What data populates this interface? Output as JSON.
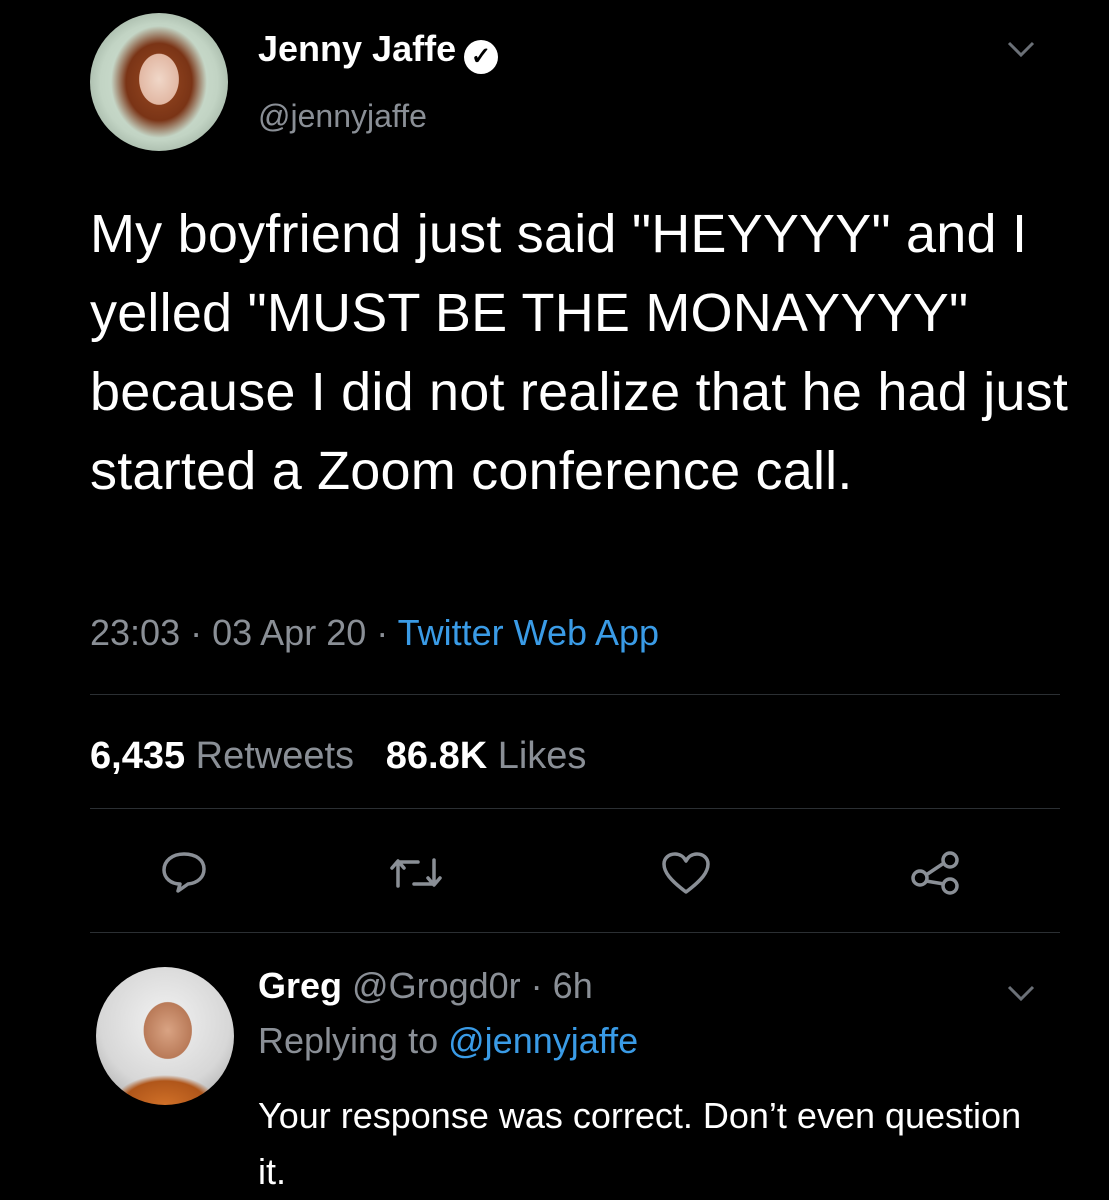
{
  "tweet": {
    "author_name": "Jenny Jaffe",
    "author_handle": "@jennyjaffe",
    "verified_icon": "verified-check-icon",
    "text": "My boyfriend just said \"HEYYYY\" and I yelled \"MUST BE THE MONAYYYY\" because I did not realize that he had just started a Zoom conference call.",
    "time": "23:03",
    "date": "03 Apr 20",
    "source": "Twitter Web App",
    "retweets_count": "6,435",
    "retweets_label": "Retweets",
    "likes_count": "86.8K",
    "likes_label": "Likes",
    "actions": [
      "reply-icon",
      "retweet-icon",
      "like-icon",
      "share-icon"
    ]
  },
  "reply": {
    "author_name": "Greg",
    "author_handle": "@Grogd0r",
    "age": "6h",
    "replying_prefix": "Replying to",
    "replying_to": "@jennyjaffe",
    "text": "Your response was correct.  Don’t even question it."
  },
  "colors": {
    "background": "#000000",
    "text": "#ffffff",
    "muted": "#8a8f96",
    "link": "#3a9be6"
  }
}
